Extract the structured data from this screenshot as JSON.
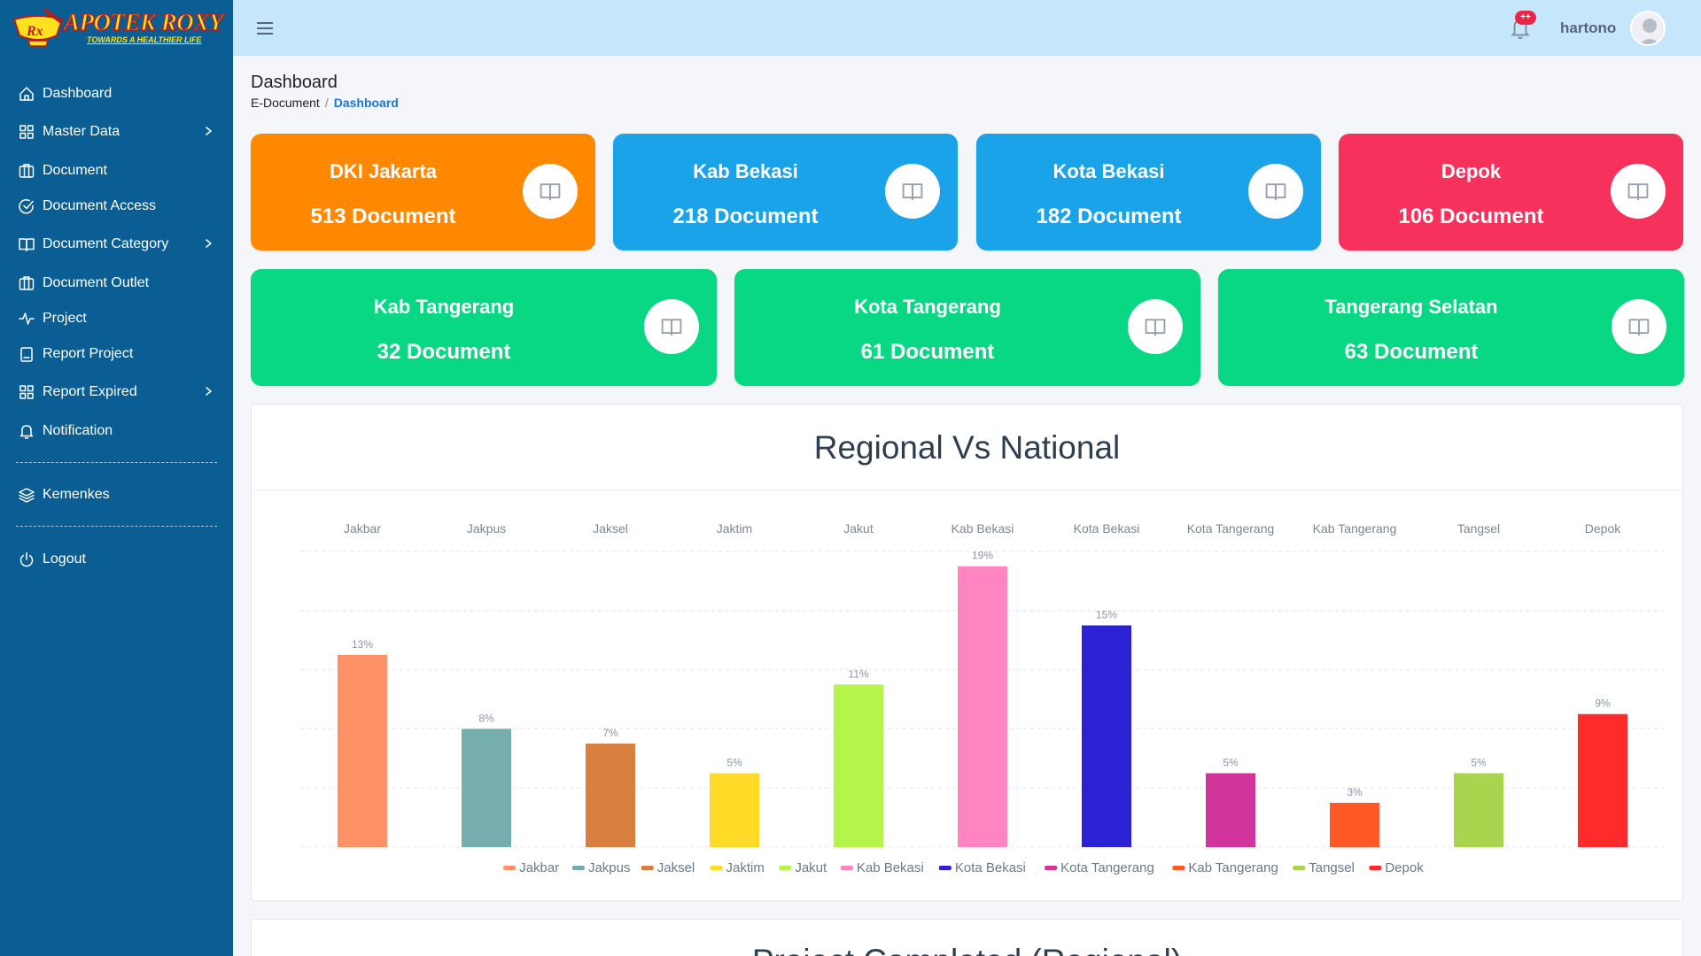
{
  "brand": {
    "name": "APOTEK ROXY",
    "tagline": "TOWARDS A HEALTHIER LIFE"
  },
  "sidebar": {
    "items": [
      {
        "label": "Dashboard",
        "icon": "home-icon"
      },
      {
        "label": "Master Data",
        "icon": "grid-icon",
        "has_submenu": true
      },
      {
        "label": "Document",
        "icon": "folder-icon"
      },
      {
        "label": "Document Access",
        "icon": "check-circle-icon"
      },
      {
        "label": "Document Category",
        "icon": "book-icon",
        "has_submenu": true
      },
      {
        "label": "Document Outlet",
        "icon": "folder-icon"
      },
      {
        "label": "Project",
        "icon": "activity-icon"
      },
      {
        "label": "Report Project",
        "icon": "clipboard-icon"
      },
      {
        "label": "Report Expired",
        "icon": "grid-icon",
        "has_submenu": true
      },
      {
        "label": "Notification",
        "icon": "bell-icon"
      },
      {
        "label": "Kemenkes",
        "icon": "layers-icon"
      },
      {
        "label": "Logout",
        "icon": "power-icon"
      }
    ]
  },
  "topbar": {
    "username": "hartono",
    "notification_badge": "++"
  },
  "header": {
    "title": "Dashboard",
    "breadcrumb": [
      "E-Document",
      "Dashboard"
    ]
  },
  "cards_row1": [
    {
      "title": "DKI Jakarta",
      "count": "513 Document",
      "color": "#ff8800"
    },
    {
      "title": "Kab Bekasi",
      "count": "218 Document",
      "color": "#1ba3ea"
    },
    {
      "title": "Kota Bekasi",
      "count": "182 Document",
      "color": "#1ba3ea"
    },
    {
      "title": "Depok",
      "count": "106 Document",
      "color": "#f5315c"
    }
  ],
  "cards_row2": [
    {
      "title": "Kab Tangerang",
      "count": "32 Document",
      "color": "#08d883"
    },
    {
      "title": "Kota Tangerang",
      "count": "61 Document",
      "color": "#08d883"
    },
    {
      "title": "Tangerang Selatan",
      "count": "63 Document",
      "color": "#08d883"
    }
  ],
  "chart_data": {
    "type": "bar",
    "title": "Regional Vs National",
    "categories": [
      "Jakbar",
      "Jakpus",
      "Jaksel",
      "Jaktim",
      "Jakut",
      "Kab Bekasi",
      "Kota Bekasi",
      "Kota Tangerang",
      "Kab Tangerang",
      "Tangsel",
      "Depok"
    ],
    "values": [
      13,
      8,
      7,
      5,
      11,
      19,
      15,
      5,
      3,
      5,
      9
    ],
    "value_labels": [
      "13%",
      "8%",
      "7%",
      "5%",
      "11%",
      "19%",
      "15%",
      "5%",
      "3%",
      "5%",
      "9%"
    ],
    "colors": [
      "#ff9166",
      "#76adaf",
      "#d97f3f",
      "#ffdb28",
      "#b5f44a",
      "#ff84c1",
      "#2a22d3",
      "#d1349a",
      "#ff5a26",
      "#a8d44e",
      "#ff2a2a"
    ],
    "category_axis_position": "top",
    "ylim": [
      0,
      20
    ],
    "grid": true,
    "legend_position": "bottom"
  },
  "panel2": {
    "title": "Project Completed (Regional)"
  }
}
